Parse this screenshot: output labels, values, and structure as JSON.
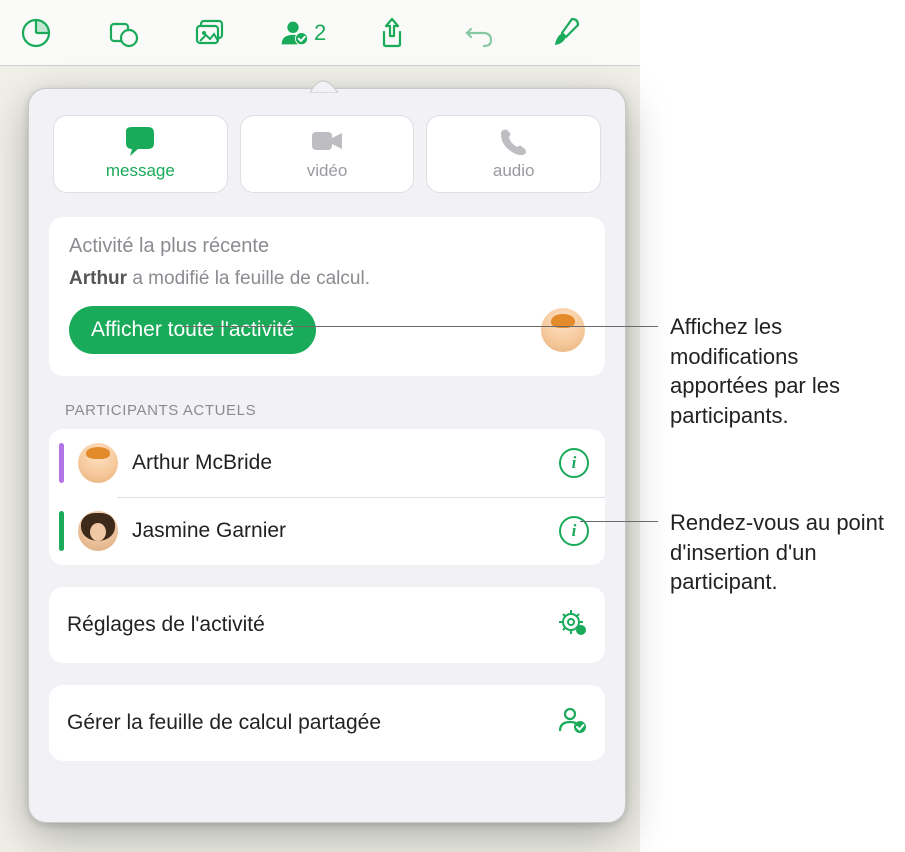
{
  "toolbar": {
    "collaborator_count": "2"
  },
  "comm": {
    "message": "message",
    "video": "vidéo",
    "audio": "audio"
  },
  "activity": {
    "title": "Activité la plus récente",
    "actor": "Arthur",
    "text": " a modifié la feuille de calcul.",
    "button": "Afficher toute l'activité"
  },
  "participants": {
    "section_label": "PARTICIPANTS ACTUELS",
    "items": [
      {
        "name": "Arthur McBride",
        "color": "#b273e6"
      },
      {
        "name": "Jasmine Garnier",
        "color": "#1aab5a"
      }
    ]
  },
  "settings": {
    "activity_settings": "Réglages de l'activité",
    "manage_shared": "Gérer la feuille de calcul partagée"
  },
  "callouts": {
    "c1": "Affichez les modifications apportées par les participants.",
    "c2": "Rendez-vous au point d'insertion d'un participant."
  }
}
